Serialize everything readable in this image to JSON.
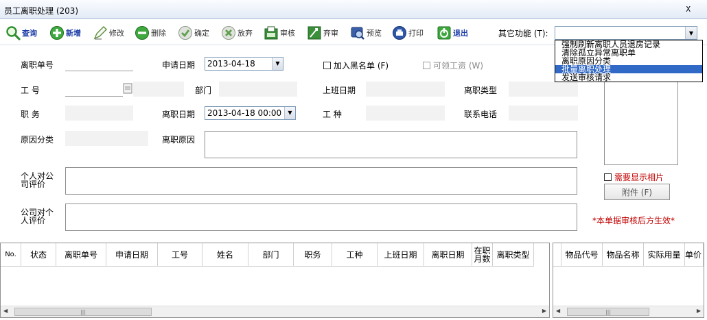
{
  "window": {
    "title": "员工离职处理 (203)",
    "close": "X"
  },
  "toolbar": {
    "buttons": [
      {
        "label": "查询",
        "icon": "search-icon"
      },
      {
        "label": "新增",
        "icon": "add-icon"
      },
      {
        "label": "修改",
        "icon": "edit-icon"
      },
      {
        "label": "删除",
        "icon": "delete-icon"
      },
      {
        "label": "确定",
        "icon": "check-icon"
      },
      {
        "label": "放弃",
        "icon": "cancel-icon"
      },
      {
        "label": "审核",
        "icon": "audit-icon"
      },
      {
        "label": "弃审",
        "icon": "unaudit-icon"
      },
      {
        "label": "预览",
        "icon": "preview-icon"
      },
      {
        "label": "打印",
        "icon": "print-icon"
      },
      {
        "label": "退出",
        "icon": "exit-icon"
      }
    ],
    "other_label": "其它功能 (T):",
    "dropdown_options": [
      "强制刷新离职人员退房记录",
      "清除孤立异常离职单",
      "离职原因分类",
      "批量离职处理",
      "发送审核请求"
    ],
    "dropdown_selected": "批量离职处理"
  },
  "form": {
    "order_no_label": "离职单号",
    "apply_date_label": "申请日期",
    "apply_date_value": "2013-04-18",
    "blacklist_label": "加入黑名单 (F)",
    "wage_label": "可领工资 (W)",
    "emp_no_label": "工  号",
    "dept_label": "部门",
    "start_date_label": "上班日期",
    "leave_type_label": "离职类型",
    "position_label": "职  务",
    "leave_date_label": "离职日期",
    "leave_date_value": "2013-04-18 00:00",
    "job_type_label": "工  种",
    "phone_label": "联系电话",
    "reason_cat_label": "原因分类",
    "reason_label": "离职原因",
    "personal_eval_label": "个人对公司评价",
    "company_eval_label": "公司对个人评价",
    "show_photo_label": "需要显示相片",
    "attach_label": "附件 (F)",
    "notice": "*本单据审核后方生效*"
  },
  "grid": {
    "columns": [
      "No.",
      "状态",
      "离职单号",
      "申请日期",
      "工号",
      "姓名",
      "部门",
      "职务",
      "工种",
      "上班日期",
      "离职日期",
      "在职月数",
      "离职类型"
    ],
    "side_columns": [
      "物品代号",
      "物品名称",
      "实际用量",
      "单价"
    ]
  },
  "colors": {
    "selected": "#3169c6",
    "notice": "#c00000",
    "field_bg": "#f2f2f2"
  }
}
